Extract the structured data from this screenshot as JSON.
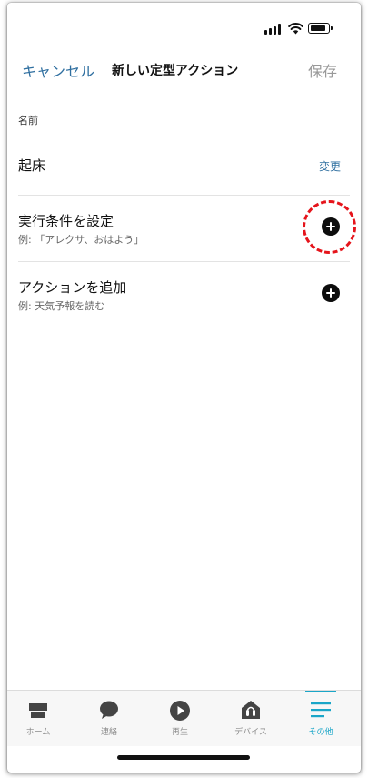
{
  "nav": {
    "cancel_label": "キャンセル",
    "title": "新しい定型アクション",
    "save_label": "保存"
  },
  "form": {
    "name_section_label": "名前",
    "name_value": "起床",
    "change_label": "変更",
    "trigger": {
      "title": "実行条件を設定",
      "example": "例: 「アレクサ、おはよう」"
    },
    "action": {
      "title": "アクションを追加",
      "example": "例: 天気予報を読む"
    }
  },
  "tabbar": {
    "tabs": [
      {
        "label": "ホーム",
        "icon": "home-icon"
      },
      {
        "label": "連絡",
        "icon": "chat-bubble-icon"
      },
      {
        "label": "再生",
        "icon": "play-icon"
      },
      {
        "label": "デバイス",
        "icon": "devices-icon"
      },
      {
        "label": "その他",
        "icon": "menu-icon",
        "active": true
      }
    ]
  },
  "colors": {
    "link": "#2f6fa0",
    "accent": "#1aa6c8",
    "highlight": "#e5141b"
  }
}
